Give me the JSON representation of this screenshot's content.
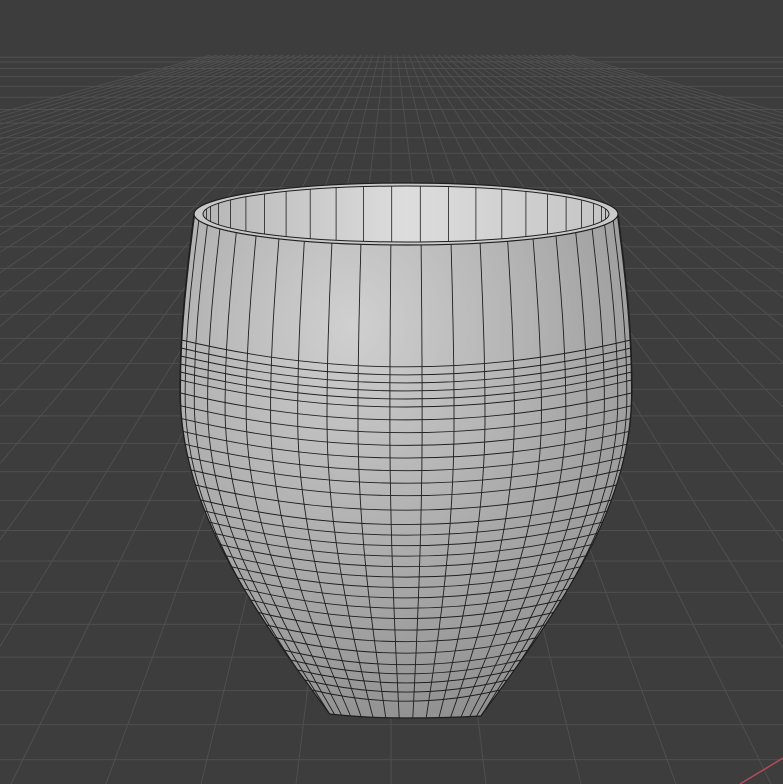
{
  "viewport": {
    "background": "#3d3d3d",
    "grid_color": "#4f4f4f",
    "x_axis_color": "#b34a5a",
    "mesh": {
      "object": "cup-mesh",
      "surface_color": "#a9a9a9",
      "highlight_color": "#d2d2d2",
      "wire_color": "#1e1e1e",
      "vertical_edge_count": 22,
      "horizontal_loop_count": 34
    }
  }
}
